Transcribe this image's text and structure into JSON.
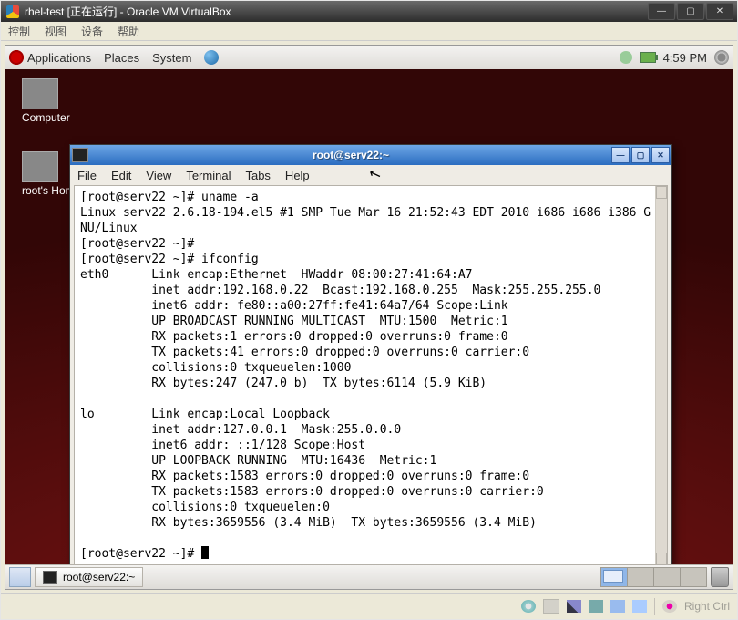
{
  "vb": {
    "title": "rhel-test [正在运行] - Oracle VM VirtualBox",
    "menus": [
      "控制",
      "视图",
      "设备",
      "帮助"
    ],
    "host_key": "Right Ctrl"
  },
  "gnome_top": {
    "items": [
      "Applications",
      "Places",
      "System"
    ],
    "time": "4:59 PM"
  },
  "desktop_icons": [
    {
      "label": "Computer"
    },
    {
      "label": "root's Home"
    }
  ],
  "gnome_bottom": {
    "task_title": "root@serv22:~"
  },
  "terminal": {
    "title": "root@serv22:~",
    "menus_html": [
      "<u>F</u>ile",
      "<u>E</u>dit",
      "<u>V</u>iew",
      "<u>T</u>erminal",
      "Ta<u>b</u>s",
      "<u>H</u>elp"
    ],
    "prompt": "[root@serv22 ~]# ",
    "lines": [
      "[root@serv22 ~]# uname -a",
      "Linux serv22 2.6.18-194.el5 #1 SMP Tue Mar 16 21:52:43 EDT 2010 i686 i686 i386 G",
      "NU/Linux",
      "[root@serv22 ~]# ",
      "[root@serv22 ~]# ifconfig",
      "eth0      Link encap:Ethernet  HWaddr 08:00:27:41:64:A7",
      "          inet addr:192.168.0.22  Bcast:192.168.0.255  Mask:255.255.255.0",
      "          inet6 addr: fe80::a00:27ff:fe41:64a7/64 Scope:Link",
      "          UP BROADCAST RUNNING MULTICAST  MTU:1500  Metric:1",
      "          RX packets:1 errors:0 dropped:0 overruns:0 frame:0",
      "          TX packets:41 errors:0 dropped:0 overruns:0 carrier:0",
      "          collisions:0 txqueuelen:1000",
      "          RX bytes:247 (247.0 b)  TX bytes:6114 (5.9 KiB)",
      "",
      "lo        Link encap:Local Loopback",
      "          inet addr:127.0.0.1  Mask:255.0.0.0",
      "          inet6 addr: ::1/128 Scope:Host",
      "          UP LOOPBACK RUNNING  MTU:16436  Metric:1",
      "          RX packets:1583 errors:0 dropped:0 overruns:0 frame:0",
      "          TX packets:1583 errors:0 dropped:0 overruns:0 carrier:0",
      "          collisions:0 txqueuelen:0",
      "          RX bytes:3659556 (3.4 MiB)  TX bytes:3659556 (3.4 MiB)",
      ""
    ]
  }
}
